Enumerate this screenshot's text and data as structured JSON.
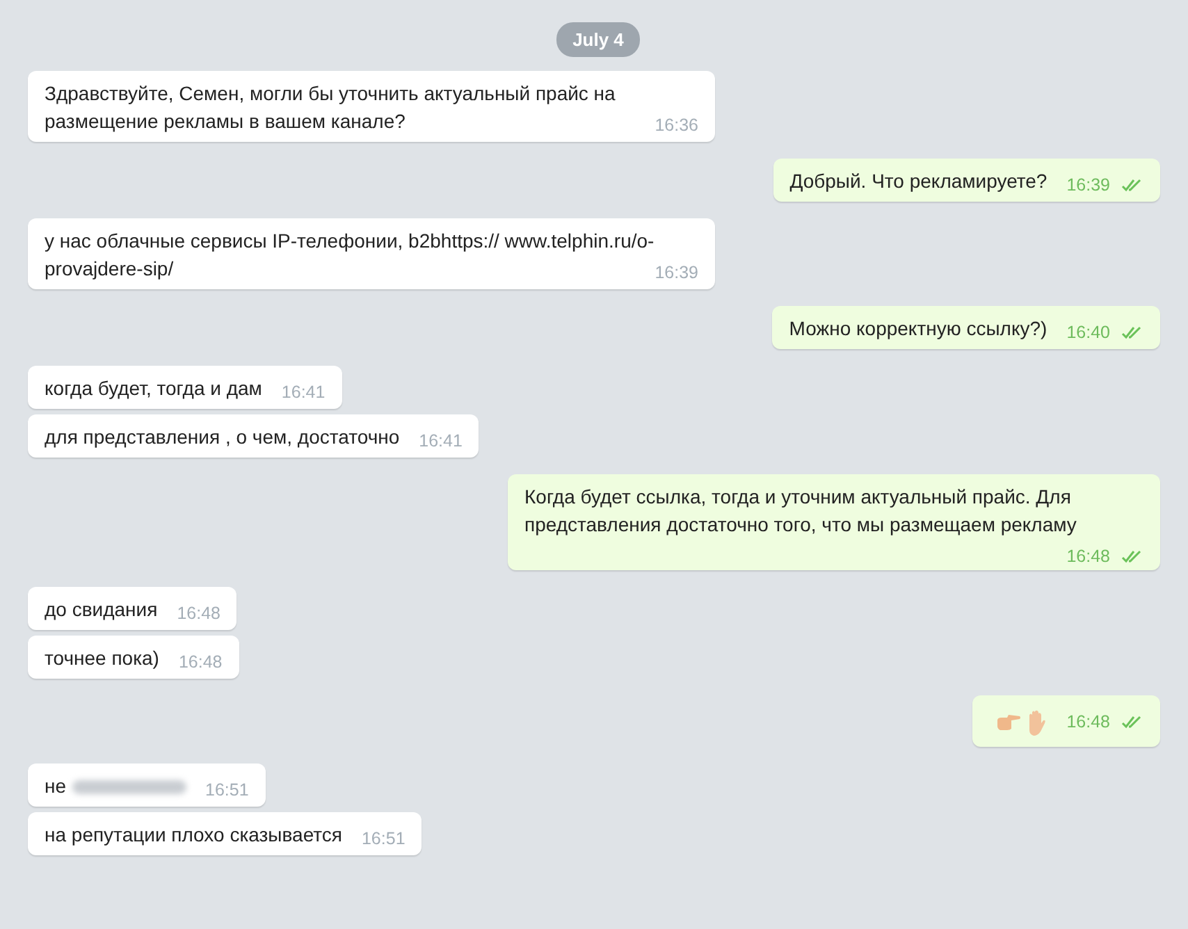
{
  "date_badge": "July 4",
  "groups": [
    {
      "outgoing": false,
      "messages": [
        {
          "kind": "text",
          "text": "Здравствуйте, Семен, могли бы уточнить актуальный прайс на размещение рекламы в вашем канале?",
          "time": "16:36"
        }
      ]
    },
    {
      "outgoing": true,
      "messages": [
        {
          "kind": "text",
          "text": "Добрый. Что рекламируете?",
          "time": "16:39",
          "read": true
        }
      ]
    },
    {
      "outgoing": false,
      "messages": [
        {
          "kind": "text",
          "text": "у нас облачные сервисы IP-телефонии, b2bhttps:// www.telphin.ru/o-provajdere-sip/",
          "time": "16:39"
        }
      ]
    },
    {
      "outgoing": true,
      "messages": [
        {
          "kind": "text",
          "text": "Можно корректную ссылку?)",
          "time": "16:40",
          "read": true
        }
      ]
    },
    {
      "outgoing": false,
      "messages": [
        {
          "kind": "text",
          "text": "когда будет, тогда и дам",
          "time": "16:41"
        },
        {
          "kind": "text",
          "text": "для представления , о чем, достаточно",
          "time": "16:41"
        }
      ]
    },
    {
      "outgoing": true,
      "messages": [
        {
          "kind": "text",
          "text": "Когда будет ссылка, тогда и уточним актуальный прайс. Для представления достаточно того, что мы размещаем рекламу",
          "time": "16:48",
          "read": true
        }
      ]
    },
    {
      "outgoing": false,
      "messages": [
        {
          "kind": "text",
          "text": "до свидания",
          "time": "16:48"
        },
        {
          "kind": "text",
          "text": "точнее пока)",
          "time": "16:48"
        }
      ]
    },
    {
      "outgoing": true,
      "messages": [
        {
          "kind": "emoji",
          "time": "16:48",
          "read": true
        }
      ]
    },
    {
      "outgoing": false,
      "messages": [
        {
          "kind": "text",
          "text": "не",
          "redacted": true,
          "time": "16:51"
        },
        {
          "kind": "text",
          "text": "на репутации плохо сказывается",
          "time": "16:51"
        }
      ]
    }
  ]
}
